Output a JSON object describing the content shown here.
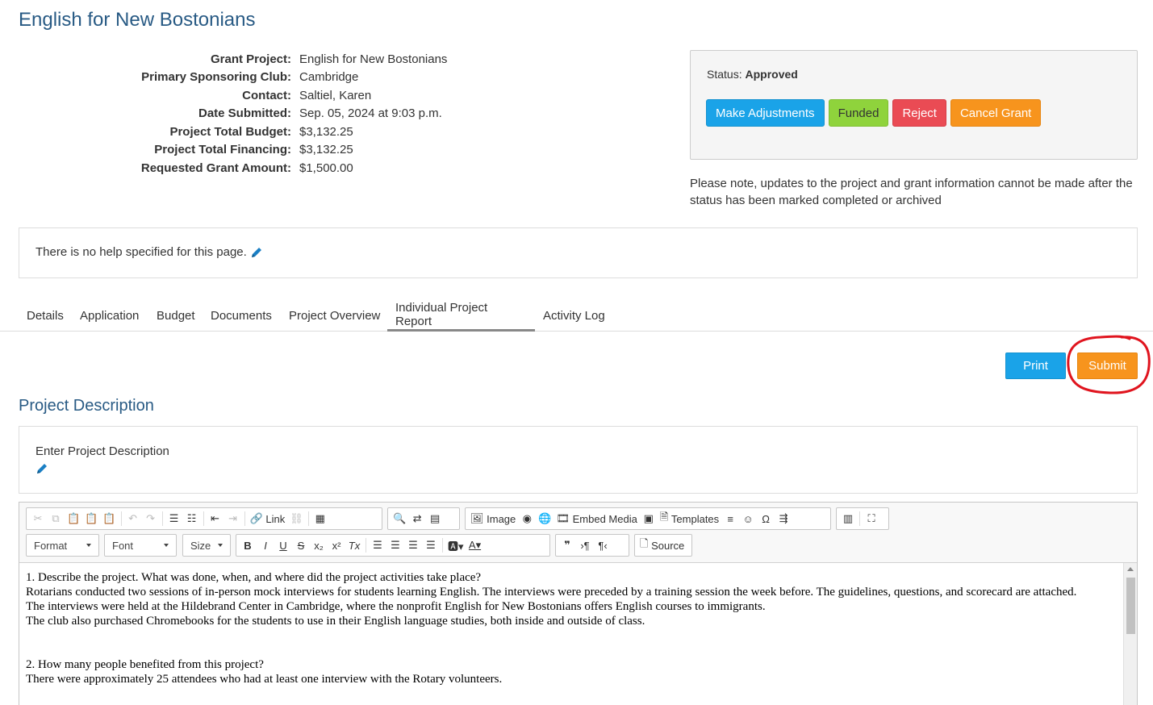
{
  "page": {
    "title": "English for New Bostonians"
  },
  "info": [
    {
      "label": "Grant Project:",
      "value": "English for New Bostonians"
    },
    {
      "label": "Primary Sponsoring Club:",
      "value": "Cambridge"
    },
    {
      "label": "Contact:",
      "value": "Saltiel, Karen"
    },
    {
      "label": "Date Submitted:",
      "value": "Sep. 05, 2024 at 9:03 p.m."
    },
    {
      "label": "Project Total Budget:",
      "value": "$3,132.25"
    },
    {
      "label": "Project Total Financing:",
      "value": "$3,132.25"
    },
    {
      "label": "Requested Grant Amount:",
      "value": "$1,500.00"
    }
  ],
  "status": {
    "label": "Status:",
    "value": "Approved",
    "buttons": {
      "make_adjustments": "Make Adjustments",
      "funded": "Funded",
      "reject": "Reject",
      "cancel_grant": "Cancel Grant"
    }
  },
  "note": "Please note, updates to the project and grant information cannot be made after the status has been marked completed or archived",
  "help": {
    "text": "There is no help specified for this page."
  },
  "tabs": [
    {
      "label": "Details"
    },
    {
      "label": "Application"
    },
    {
      "label": "Budget"
    },
    {
      "label": "Documents"
    },
    {
      "label": "Project Overview"
    },
    {
      "label": "Individual Project Report",
      "active": true
    },
    {
      "label": "Activity Log"
    }
  ],
  "actions": {
    "print": "Print",
    "submit": "Submit"
  },
  "section": {
    "title": "Project Description",
    "prompt": "Enter Project Description"
  },
  "editor": {
    "toolbar": {
      "link": "Link",
      "image": "Image",
      "embed_media": "Embed Media",
      "templates": "Templates",
      "source": "Source",
      "format": "Format",
      "font": "Font",
      "size": "Size"
    },
    "lines": [
      "1. Describe the project. What was done, when, and where did the project activities take place?",
      "Rotarians conducted two sessions of in-person mock interviews for students learning English. The interviews were preceded by a training session the week before. The guidelines, questions, and scorecard are attached.",
      "The interviews were held at the Hildebrand Center in Cambridge, where the nonprofit English for New Bostonians offers English courses to immigrants.",
      "The club also purchased Chromebooks for the students to use in their English language studies, both inside and outside of class.",
      "",
      "",
      "2. How many people benefited from this project?",
      "There were approximately 25 attendees who had at least one interview with the Rotary volunteers."
    ]
  },
  "colors": {
    "title": "#285a84",
    "blue_button": "#1aa3e8",
    "green_button": "#8fd33c",
    "red_button": "#ea4b54",
    "orange_button": "#f7941d",
    "annotation_circle": "#e0141e"
  }
}
